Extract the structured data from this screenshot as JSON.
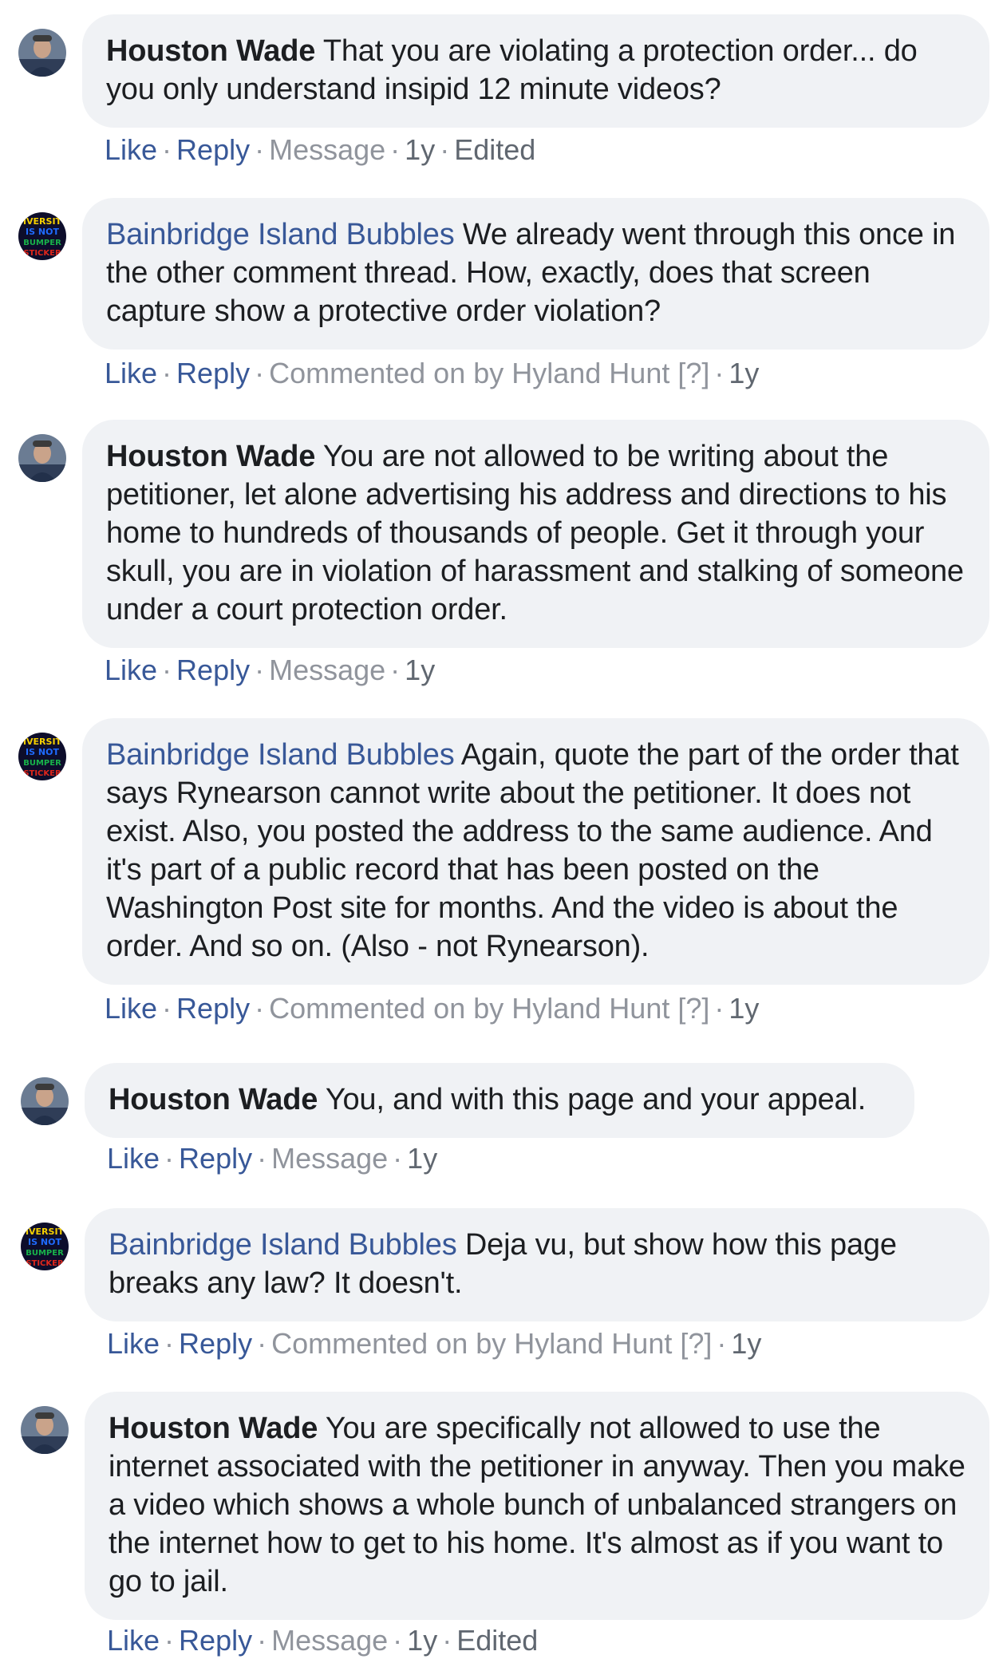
{
  "comments": [
    {
      "author": "Houston Wade",
      "author_type": "person",
      "text": "That you are violating a protection order... do you only understand insipid 12 minute videos?",
      "like": "Like",
      "reply": "Reply",
      "meta": "Message",
      "time": "1y",
      "extra": "Edited"
    },
    {
      "author": "Bainbridge Island Bubbles",
      "author_type": "page",
      "text": "We already went through this once in the other comment thread. How, exactly, does that screen capture show a protective order violation?",
      "like": "Like",
      "reply": "Reply",
      "meta": "Commented on by Hyland Hunt [?]",
      "time": "1y",
      "extra": ""
    },
    {
      "author": "Houston Wade",
      "author_type": "person",
      "text": "You are not allowed to be writing about the petitioner, let alone advertising his address and directions to his home to hundreds of thousands of people. Get it through your skull, you are in violation of harassment and stalking of someone under a court protection order.",
      "like": "Like",
      "reply": "Reply",
      "meta": "Message",
      "time": "1y",
      "extra": ""
    },
    {
      "author": "Bainbridge Island Bubbles",
      "author_type": "page",
      "text": "Again, quote the part of the order that says Rynearson cannot write about the petitioner. It does not exist. Also, you posted the address to the same audience. And it's part of a public record that has been posted on the Washington Post site for months. And the video is about the order. And so on. (Also - not Rynearson).",
      "like": "Like",
      "reply": "Reply",
      "meta": "Commented on by Hyland Hunt [?]",
      "time": "1y",
      "extra": ""
    },
    {
      "author": "Houston Wade",
      "author_type": "person",
      "text": "You, and with this page and your appeal.",
      "like": "Like",
      "reply": "Reply",
      "meta": "Message",
      "time": "1y",
      "extra": ""
    },
    {
      "author": "Bainbridge Island Bubbles",
      "author_type": "page",
      "text": "Deja vu, but show how this page breaks any law? It doesn't.",
      "like": "Like",
      "reply": "Reply",
      "meta": "Commented on by Hyland Hunt [?]",
      "time": "1y",
      "extra": ""
    },
    {
      "author": "Houston Wade",
      "author_type": "person",
      "text": "You are specifically not allowed to use the internet associated with the petitioner in anyway. Then you make a video which shows a whole bunch of unbalanced strangers on the internet how to get to his home. It's almost as if you want to go to jail.",
      "like": "Like",
      "reply": "Reply",
      "meta": "Message",
      "time": "1y",
      "extra": "Edited"
    }
  ],
  "avatar_page_text": [
    "IVERSIT",
    "IS NOT",
    "BUMPER",
    "STICKER"
  ],
  "colors": {
    "link": "#385898",
    "bubble": "#f0f2f5",
    "meta": "#90949c"
  },
  "icons": {
    "person_avatar": "profile-photo-icon",
    "page_avatar": "page-logo-icon"
  }
}
